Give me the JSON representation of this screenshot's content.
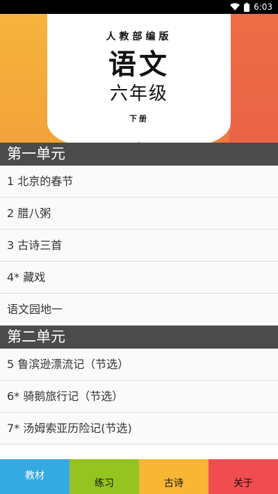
{
  "status_bar": {
    "time": "6:03",
    "icons": [
      "wifi-icon",
      "battery-icon"
    ]
  },
  "banner": {
    "publisher": "人教部编版",
    "subject": "语文",
    "grade": "六年级",
    "volume": "下册"
  },
  "units": [
    {
      "title": "第一单元",
      "lessons": [
        "1 北京的春节",
        "2 腊八粥",
        "3 古诗三首",
        "4* 藏戏",
        "语文园地一"
      ]
    },
    {
      "title": "第二单元",
      "lessons": [
        "5 鲁滨逊漂流记（节选）",
        "6* 骑鹅旅行记（节选）",
        "7* 汤姆索亚历险记(节选)"
      ]
    }
  ],
  "bottom_nav": {
    "items": [
      "教材",
      "练习",
      "古诗",
      "关于"
    ],
    "colors": [
      "#35a9e1",
      "#95c420",
      "#f8b634",
      "#ef4d4f"
    ],
    "active": "教材"
  }
}
